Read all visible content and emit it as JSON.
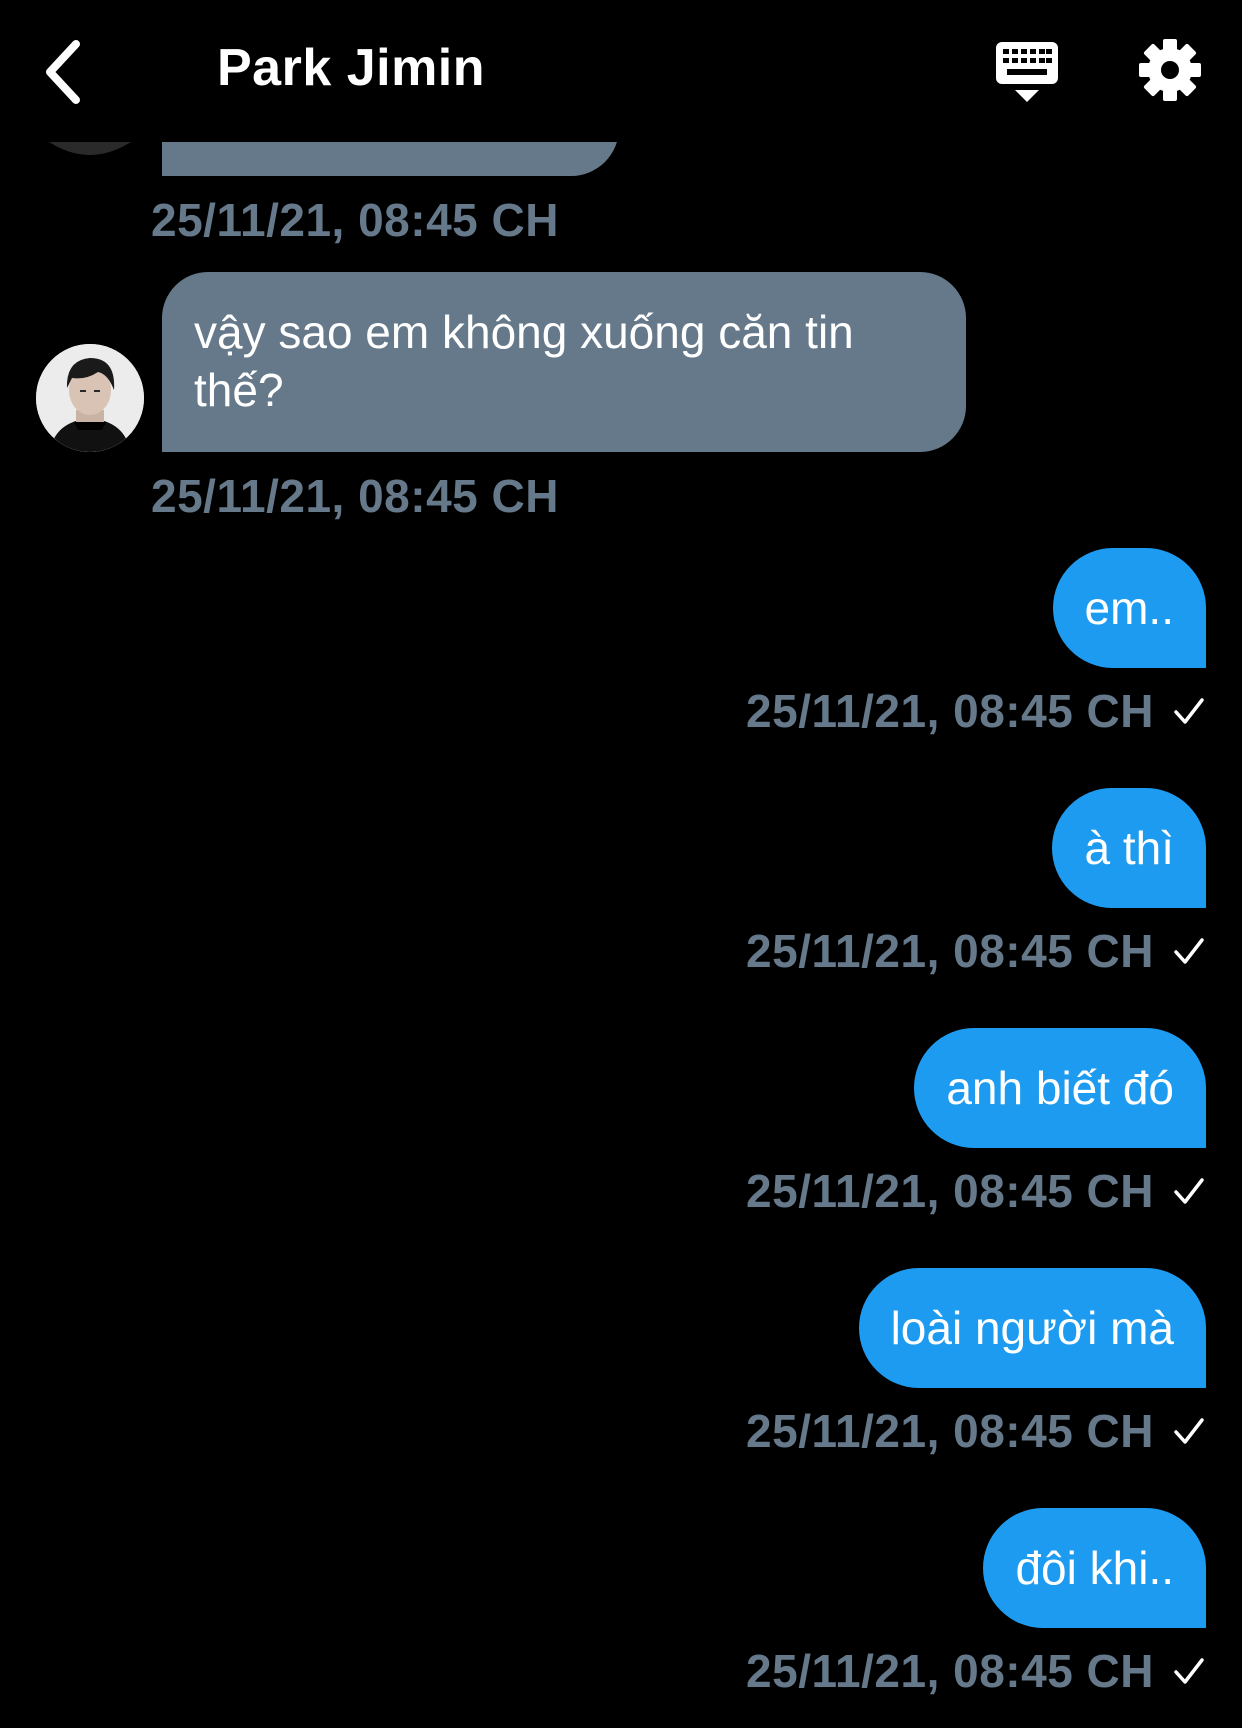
{
  "header": {
    "title": "Park Jimin",
    "back_icon": "chevron-left-icon",
    "keyboard_icon": "keyboard-icon",
    "settings_icon": "gear-icon"
  },
  "colors": {
    "background": "#000000",
    "incoming_bubble": "#66798a",
    "outgoing_bubble": "#1d9bf0",
    "timestamp": "#66798a"
  },
  "messages": {
    "partial_timestamp": "25/11/21, 08:45 CH",
    "incoming": [
      {
        "text": "vậy sao em không xuống căn tin thế?",
        "timestamp": "25/11/21, 08:45 CH"
      }
    ],
    "outgoing": [
      {
        "text": "em..",
        "timestamp": "25/11/21, 08:45 CH",
        "status": "✓"
      },
      {
        "text": "à thì",
        "timestamp": "25/11/21, 08:45 CH",
        "status": "✓"
      },
      {
        "text": "anh biết đó",
        "timestamp": "25/11/21, 08:45 CH",
        "status": "✓"
      },
      {
        "text": "loài người mà",
        "timestamp": "25/11/21, 08:45 CH",
        "status": "✓"
      },
      {
        "text": "đôi khi..",
        "timestamp": "25/11/21, 08:45 CH",
        "status": "✓"
      }
    ]
  }
}
